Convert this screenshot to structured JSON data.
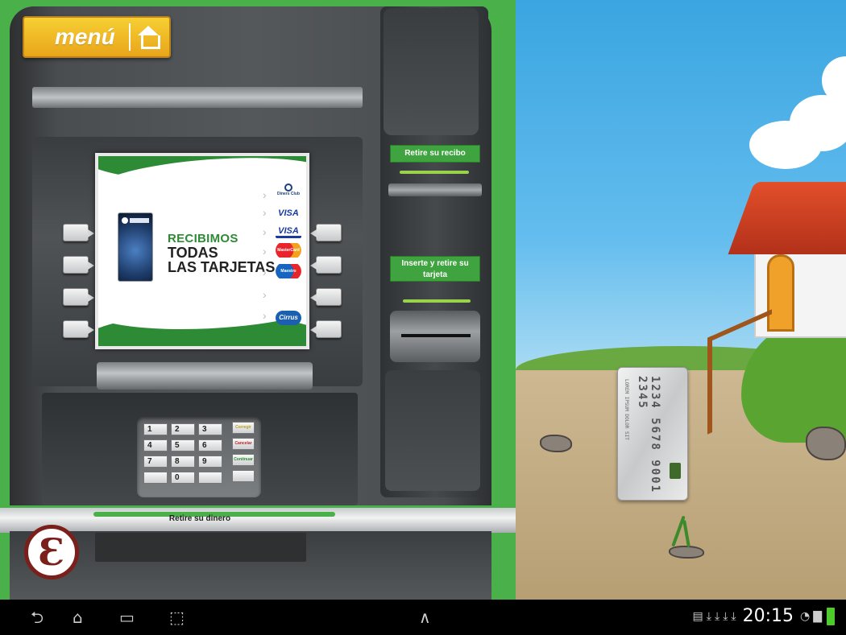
{
  "menu": {
    "label": "menú",
    "icon": "home-icon"
  },
  "atm": {
    "screen": {
      "promo_line1": "RECIBIMOS",
      "promo_line2": "TODAS",
      "promo_line3": "LAS TARJETAS",
      "brands": [
        "Diners Club",
        "VISA",
        "VISA",
        "MasterCard",
        "Maestro",
        "Cirrus"
      ]
    },
    "receipt_label": "Retire su recibo",
    "card_label": "Inserte y retire su tarjeta",
    "cash_label": "Retire su dinero",
    "keypad": {
      "keys": [
        "1",
        "2",
        "3",
        "4",
        "5",
        "6",
        "7",
        "8",
        "9",
        "0"
      ],
      "correct": "Corregir",
      "cancel": "Cancelar",
      "continue": "Continuar"
    },
    "ear_icon": "ear-icon"
  },
  "card": {
    "number": "1234 5678 9001 2345",
    "name": "LOREM IPSUM DOLOR SIT"
  },
  "navbar": {
    "back": "back-icon",
    "home": "home-nav-icon",
    "recents": "recents-icon",
    "screenshot": "screenshot-icon",
    "up": "up-arrow-icon",
    "time": "20:15"
  },
  "colors": {
    "atm_green": "#4ab04a",
    "menu_yellow": "#f2bb28",
    "screen_green": "#2d8a35",
    "ear_red": "#7a1f19"
  }
}
